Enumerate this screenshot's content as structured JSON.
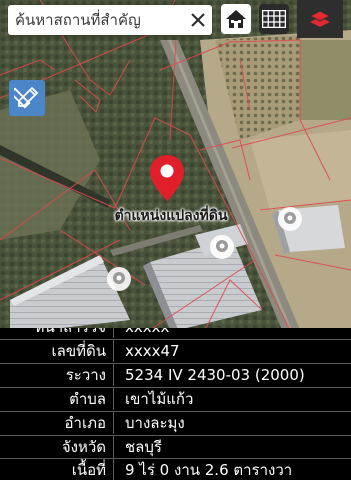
{
  "search": {
    "placeholder": "ค้นหาสถานที่สำคัญ",
    "clear_icon": "close-icon"
  },
  "toolbar": {
    "home_icon": "home-icon",
    "grid_icon": "grid-icon",
    "layers_icon": "layers-icon",
    "measure_icon": "ruler-pencil-icon"
  },
  "map": {
    "marker_label": "ตำแหน่งแปลงที่ดิน",
    "marker_color": "#e01f2b",
    "parcel_line_color": "#e0484f"
  },
  "parcel_info": {
    "partial_row": {
      "label": "หน้าสำรวจ",
      "value": "xxxxx"
    },
    "rows": [
      {
        "label": "เลขที่ดิน",
        "value": "xxxx47"
      },
      {
        "label": "ระวาง",
        "value": "5234 IV 2430-03 (2000)"
      },
      {
        "label": "ตำบล",
        "value": "เขาไม้แก้ว"
      },
      {
        "label": "อำเภอ",
        "value": "บางละมุง"
      },
      {
        "label": "จังหวัด",
        "value": "ชลบุรี"
      },
      {
        "label": "เนื้อที่",
        "value": "9 ไร่ 0 งาน 2.6 ตารางวา"
      }
    ]
  }
}
